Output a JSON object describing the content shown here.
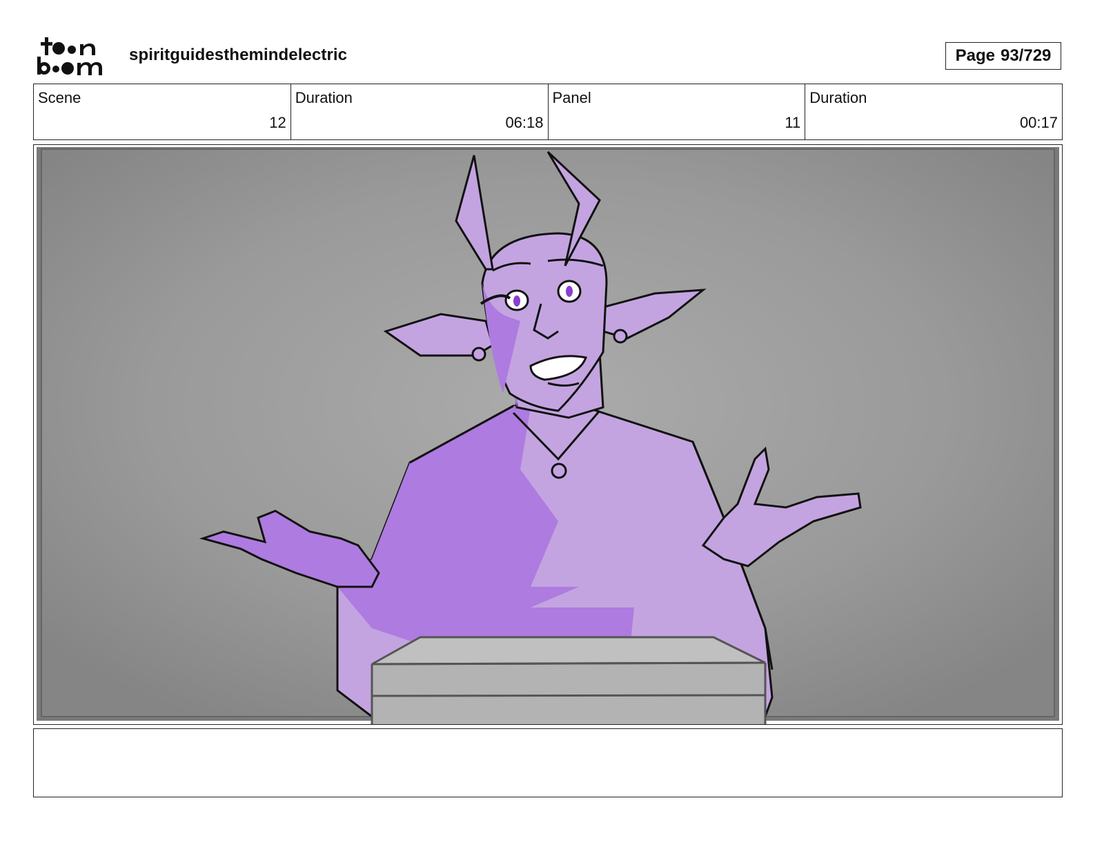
{
  "header": {
    "logo": {
      "icon": "toonboom-logo",
      "line1": "toon",
      "line2": "boom"
    },
    "project_title": "spiritguidesthemindelectric",
    "page_label": "Page",
    "page_number": "93/729"
  },
  "info": {
    "scene_label": "Scene",
    "scene_value": "12",
    "scene_duration_label": "Duration",
    "scene_duration_value": "06:18",
    "panel_label": "Panel",
    "panel_value": "11",
    "panel_duration_label": "Duration",
    "panel_duration_value": "00:17"
  },
  "panel": {
    "image": "storyboard-drawing",
    "description_colors": {
      "skin_light": "#c3a4e0",
      "skin_dark": "#ae7be0",
      "background": "#9a9a9a",
      "desk": "#b3b3b3"
    }
  },
  "notes": {
    "text": ""
  }
}
